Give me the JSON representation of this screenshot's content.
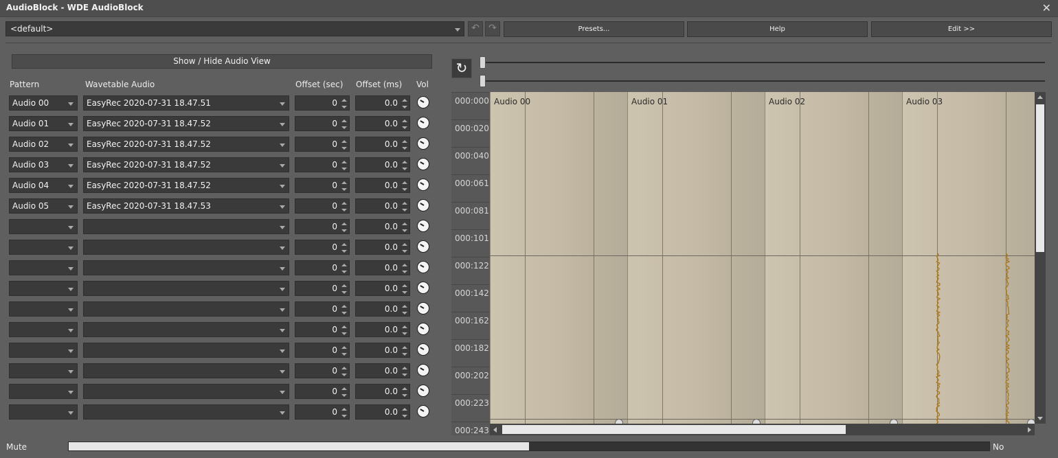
{
  "window": {
    "title": "AudioBlock - WDE AudioBlock",
    "close_glyph": "✕"
  },
  "toolbar": {
    "preset_value": "<default>",
    "undo_glyph": "↶",
    "redo_glyph": "↷",
    "presets_label": "Presets...",
    "help_label": "Help",
    "edit_label": "Edit >>"
  },
  "show_hide_label": "Show / Hide Audio View",
  "columns": {
    "pattern": "Pattern",
    "wavetable": "Wavetable Audio",
    "offset_sec": "Offset (sec)",
    "offset_ms": "Offset (ms)",
    "vol": "Vol"
  },
  "rows": [
    {
      "pattern": "Audio 00",
      "wave": "EasyRec 2020-07-31 18.47.51",
      "sec": "0",
      "ms": "0.0"
    },
    {
      "pattern": "Audio 01",
      "wave": "EasyRec 2020-07-31 18.47.52",
      "sec": "0",
      "ms": "0.0"
    },
    {
      "pattern": "Audio 02",
      "wave": "EasyRec 2020-07-31 18.47.52",
      "sec": "0",
      "ms": "0.0"
    },
    {
      "pattern": "Audio 03",
      "wave": "EasyRec 2020-07-31 18.47.52",
      "sec": "0",
      "ms": "0.0"
    },
    {
      "pattern": "Audio 04",
      "wave": "EasyRec 2020-07-31 18.47.52",
      "sec": "0",
      "ms": "0.0"
    },
    {
      "pattern": "Audio 05",
      "wave": "EasyRec 2020-07-31 18.47.53",
      "sec": "0",
      "ms": "0.0"
    },
    {
      "pattern": "",
      "wave": "",
      "sec": "0",
      "ms": "0.0"
    },
    {
      "pattern": "",
      "wave": "",
      "sec": "0",
      "ms": "0.0"
    },
    {
      "pattern": "",
      "wave": "",
      "sec": "0",
      "ms": "0.0"
    },
    {
      "pattern": "",
      "wave": "",
      "sec": "0",
      "ms": "0.0"
    },
    {
      "pattern": "",
      "wave": "",
      "sec": "0",
      "ms": "0.0"
    },
    {
      "pattern": "",
      "wave": "",
      "sec": "0",
      "ms": "0.0"
    },
    {
      "pattern": "",
      "wave": "",
      "sec": "0",
      "ms": "0.0"
    },
    {
      "pattern": "",
      "wave": "",
      "sec": "0",
      "ms": "0.0"
    },
    {
      "pattern": "",
      "wave": "",
      "sec": "0",
      "ms": "0.0"
    },
    {
      "pattern": "",
      "wave": "",
      "sec": "0",
      "ms": "0.0"
    }
  ],
  "audio_view": {
    "refresh_glyph": "↻",
    "time_labels": [
      "000:000",
      "000:020",
      "000:040",
      "000:061",
      "000:081",
      "000:101",
      "000:122",
      "000:142",
      "000:162",
      "000:182",
      "000:202",
      "000:223",
      "000:243"
    ],
    "tracks": [
      "Audio 00",
      "Audio 01",
      "Audio 02",
      "Audio 03"
    ],
    "waveform_color": "#b07a1c"
  },
  "mute": {
    "label": "Mute",
    "value": "No",
    "level": 0.5
  },
  "colors": {
    "background": "#5f5f5f",
    "track_bg": "#c5bba6",
    "control_bg": "#3a3a3a"
  }
}
